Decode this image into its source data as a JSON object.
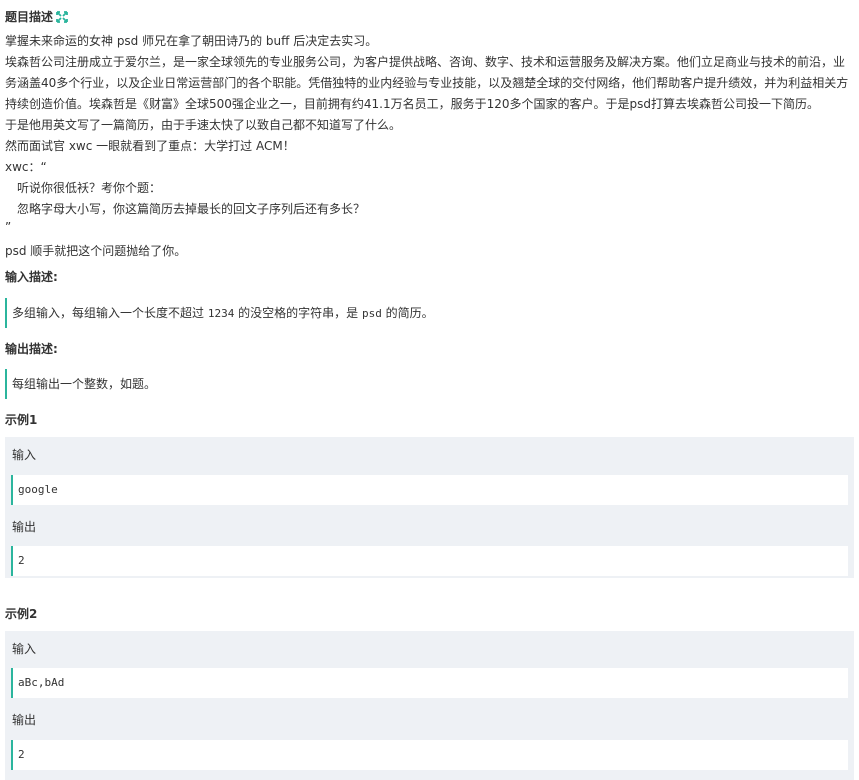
{
  "problem": {
    "title": "题目描述",
    "lines": [
      "掌握未来命运的女神 psd 师兄在拿了朝田诗乃的 buff 后决定去实习。",
      "埃森哲公司注册成立于爱尔兰，是一家全球领先的专业服务公司，为客户提供战略、咨询、数字、技术和运营服务及解决方案。他们立足商业与技术的前沿，业",
      "务涵盖40多个行业，以及企业日常运营部门的各个职能。凭借独特的业内经验与专业技能，以及翘楚全球的交付网络，他们帮助客户提升绩效，并为利益相关方",
      "持续创造价值。埃森哲是《财富》全球500强企业之一，目前拥有约41.1万名员工，服务于120多个国家的客户。于是psd打算去埃森哲公司投一下简历。",
      "于是他用英文写了一篇简历，由于手速太快了以致自己都不知道写了什么。",
      "然而面试官 xwc 一眼就看到了重点：大学打过 ACM！",
      "xwc：“",
      "听说你很低袄？考你个题：",
      "忽略字母大小写，你这篇简历去掉最长的回文子序列后还有多长？",
      "”",
      "psd 顺手就把这个问题抛给了你。"
    ]
  },
  "input_desc": {
    "title": "输入描述:",
    "text_before": "多组输入，每组输入一个长度不超过 ",
    "code1": "1234",
    "text_middle": " 的没空格的字符串，是 ",
    "code2": "psd",
    "text_after": " 的简历。"
  },
  "output_desc": {
    "title": "输出描述:",
    "text": "每组输出一个整数，如题。"
  },
  "examples": [
    {
      "title": "示例1",
      "input_label": "输入",
      "input": "google",
      "output_label": "输出",
      "output": "2"
    },
    {
      "title": "示例2",
      "input_label": "输入",
      "input": "aBc,bAd",
      "output_label": "输出",
      "output": "2"
    }
  ],
  "colors": {
    "accent": "#2bb59d",
    "example_bg": "#eef1f5"
  }
}
